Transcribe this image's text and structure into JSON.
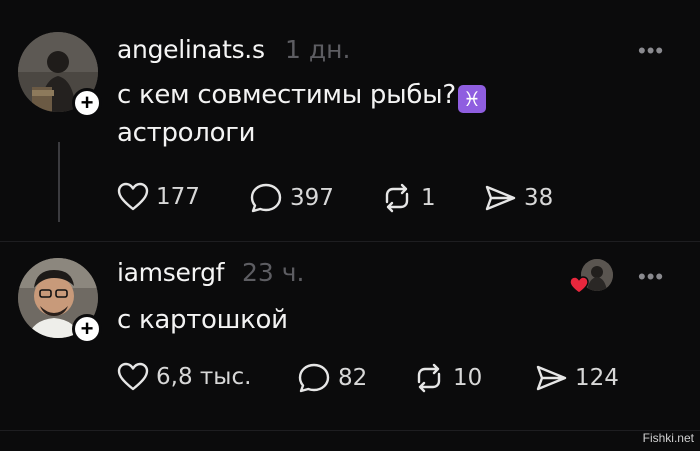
{
  "posts": [
    {
      "username": "angelinats.s",
      "time": "1 дн.",
      "text_line1": "с кем совместимы рыбы?",
      "zodiac_symbol": "♓",
      "text_line2": "астрологи",
      "stats": {
        "likes": "177",
        "comments": "397",
        "reposts": "1",
        "shares": "38"
      },
      "more_label": "•••",
      "avatar_icon": "person-photo"
    },
    {
      "username": "iamsergf",
      "time": "23 ч.",
      "text_line1": "с картошкой",
      "stats": {
        "likes": "6,8 тыс.",
        "comments": "82",
        "reposts": "10",
        "shares": "124"
      },
      "more_label": "•••",
      "avatar_icon": "person-photo",
      "liked_by_author_icon": "heart-icon"
    }
  ],
  "watermark": "Fishki.net",
  "colors": {
    "background": "#0b0b0c",
    "muted": "#5d5d62",
    "zodiac_bg": "#8f5ee0",
    "heart": "#e8273d"
  }
}
